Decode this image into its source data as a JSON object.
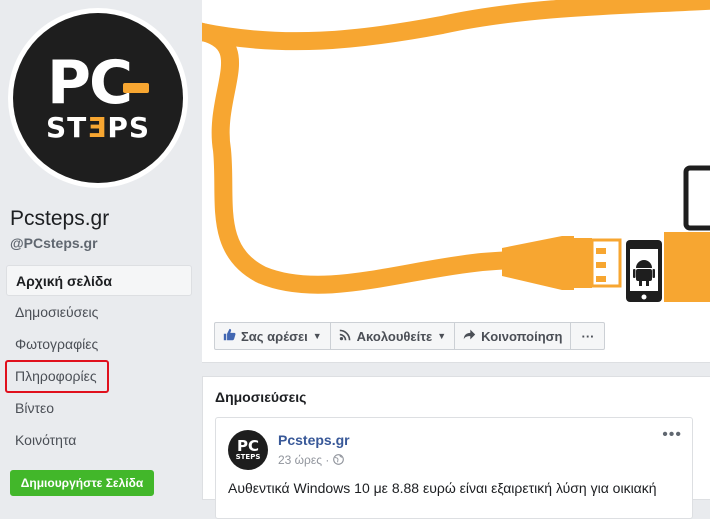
{
  "page": {
    "name": "Pcsteps.gr",
    "handle": "@PCsteps.gr"
  },
  "logo": {
    "line1": "PC",
    "line2_a": "ST",
    "line2_e": "Ǝ",
    "line2_b": "PS",
    "small1": "PC",
    "small2": "STEPS"
  },
  "nav": {
    "items": [
      {
        "label": "Αρχική σελίδα"
      },
      {
        "label": "Δημοσιεύσεις"
      },
      {
        "label": "Φωτογραφίες"
      },
      {
        "label": "Πληροφορίες"
      },
      {
        "label": "Βίντεο"
      },
      {
        "label": "Κοινότητα"
      }
    ]
  },
  "create_button": "Δημιουργήστε Σελίδα",
  "actions": {
    "like": "Σας αρέσει",
    "follow": "Ακολουθείτε",
    "share": "Κοινοποίηση",
    "more": "···"
  },
  "posts": {
    "title": "Δημοσιεύσεις",
    "first": {
      "author": "Pcsteps.gr",
      "time": "23 ώρες ·",
      "more": "•••",
      "text": "Αυθεντικά Windows 10 με 8.88 ευρώ είναι εξαιρετική λύση για οικιακή"
    }
  },
  "colors": {
    "accent_orange": "#f7a631",
    "link_blue": "#385898",
    "highlight_red": "#e0101d",
    "create_green": "#42b72a"
  }
}
